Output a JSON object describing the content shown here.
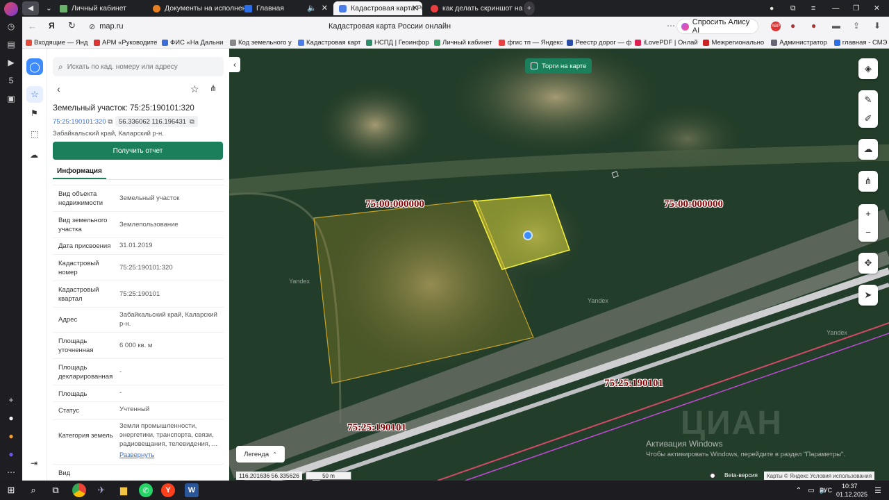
{
  "browser": {
    "tabs": [
      {
        "label": "Личный кабинет",
        "active": false
      },
      {
        "label": "Документы на исполнени",
        "active": false
      },
      {
        "label": "Главная",
        "active": false
      },
      {
        "label": "Кадастровая карта Рос",
        "active": true
      },
      {
        "label": "как делать скриншот на к",
        "active": false
      }
    ],
    "url": "map.ru",
    "page_title": "Кадастровая карта России онлайн",
    "alice_label": "Спросить Алису AI",
    "bookmarks": [
      "Входящие — Янд",
      "АРМ «Руководите",
      "ФИС «На Дальни",
      "Код земельного у",
      "Кадастровая карт",
      "НСПД | Геоинфор",
      "Личный кабинет",
      "фгис тп — Яндекс",
      "Реестр дорог — ф",
      "iLovePDF | Онлай",
      "Межрегионально",
      "Администратор",
      "главная - СМЭ"
    ]
  },
  "sidebar": {
    "search_placeholder": "Искать по кад. номеру или адресу",
    "title": "Земельный участок: 75:25:190101:320",
    "cad_link": "75:25:190101:320",
    "coords": "56.336062 116.196431",
    "region": "Забайкальский край, Каларский р-н.",
    "report_button": "Получить отчет",
    "tab_info": "Информация",
    "rows": [
      {
        "k": "Вид объекта недвижимости",
        "v": "Земельный участок"
      },
      {
        "k": "Вид земельного участка",
        "v": "Землепользование"
      },
      {
        "k": "Дата присвоения",
        "v": "31.01.2019"
      },
      {
        "k": "Кадастровый номер",
        "v": "75:25:190101:320"
      },
      {
        "k": "Кадастровый квартал",
        "v": "75:25:190101"
      },
      {
        "k": "Адрес",
        "v": "Забайкальский край, Каларский р-н."
      },
      {
        "k": "Площадь уточненная",
        "v": "6 000 кв. м"
      },
      {
        "k": "Площадь декларированная",
        "v": "-"
      },
      {
        "k": "Площадь",
        "v": "-"
      },
      {
        "k": "Статус",
        "v": "Учтенный"
      },
      {
        "k": "Категория земель",
        "v": "Земли промышленности, энергетики, транспорта, связи, радиовещания, телевидения, ..."
      },
      {
        "k": "Вид",
        "v": ""
      }
    ],
    "expand_link": "Развернуть"
  },
  "map": {
    "torgi_label": "Торги на карте",
    "labels": {
      "l1": "75:00:000000",
      "l2": "75:00:000000",
      "l3": "75:25:190101",
      "l4": "75:25:190101"
    },
    "watermark_yandex": "Yandex",
    "legend": "Легенда",
    "coord_readout": "116.201636  56.335626",
    "scale": "50 m",
    "beta": "Beta-версия",
    "copyright": "Карты © Яндекс  Условия использования",
    "activation_title": "Активация Windows",
    "activation_text": "Чтобы активировать Windows, перейдите в раздел \"Параметры\".",
    "cian": "ЦИАН"
  },
  "taskbar": {
    "lang": "РУС",
    "time": "10:37",
    "date": "01.12.2025"
  },
  "colors": {
    "accent_green": "#1a7f5a",
    "link_blue": "#3a6fd8",
    "parcel_yellow": "#e8e23a",
    "label_red": "#8b0000"
  }
}
